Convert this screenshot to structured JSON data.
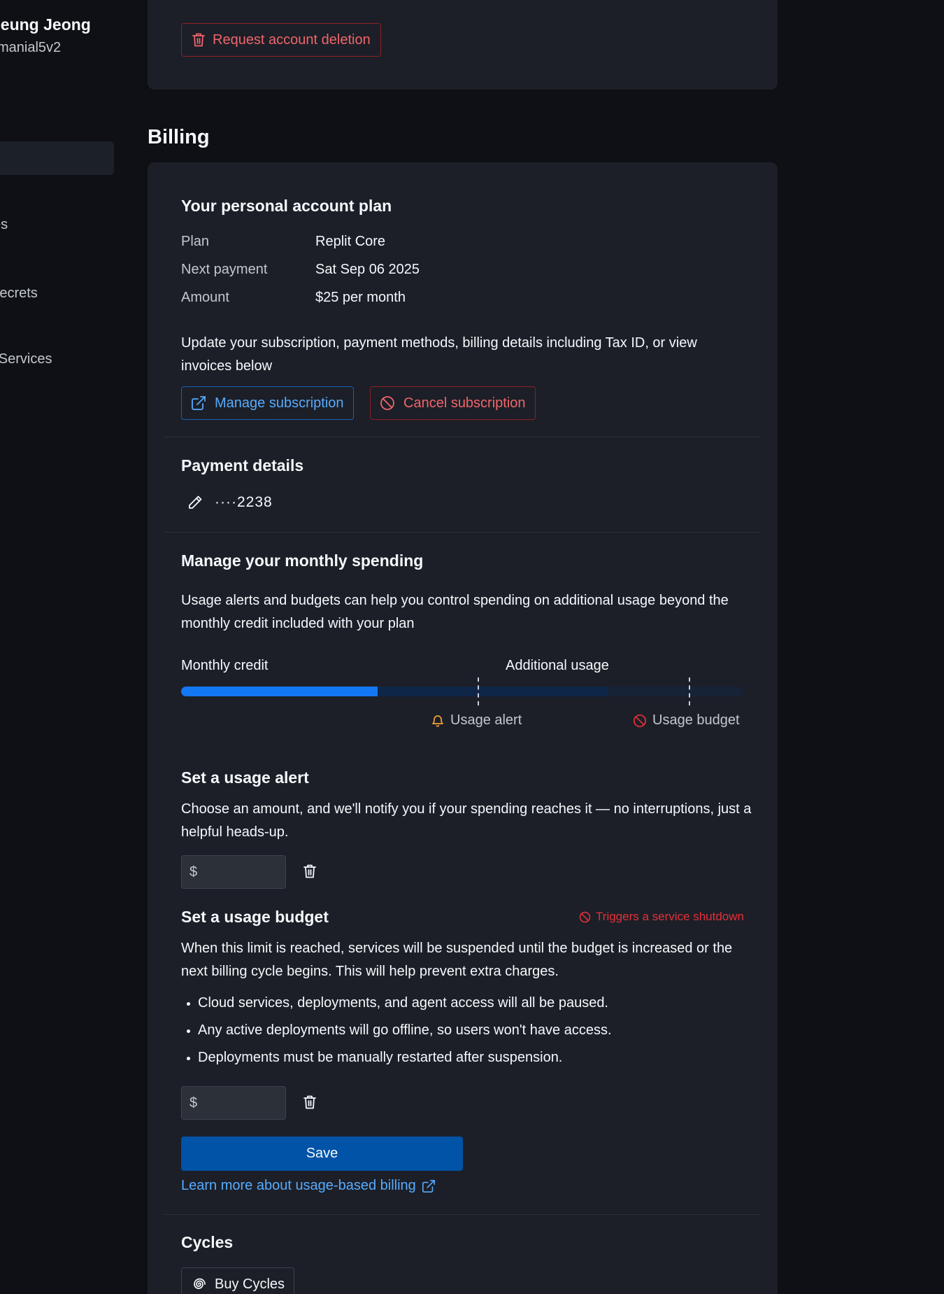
{
  "sidebar": {
    "user_name": "seung Jeong",
    "user_handle": "manial5v2",
    "items": [
      "ces",
      "Secrets",
      "ed Services"
    ]
  },
  "account": {
    "delete_label": "Request account deletion"
  },
  "billing": {
    "title": "Billing",
    "plan_section": {
      "heading": "Your personal account plan",
      "rows": [
        {
          "label": "Plan",
          "value": "Replit Core"
        },
        {
          "label": "Next payment",
          "value": "Sat Sep 06 2025"
        },
        {
          "label": "Amount",
          "value": "$25 per month"
        }
      ],
      "description": "Update your subscription, payment methods, billing details including Tax ID, or view invoices below",
      "manage_label": "Manage subscription",
      "cancel_label": "Cancel subscription"
    },
    "payment": {
      "heading": "Payment details",
      "card_number": "····2238"
    },
    "spending": {
      "heading": "Manage your monthly spending",
      "description": "Usage alerts and budgets can help you control spending on additional usage beyond the monthly credit included with your plan",
      "monthly_credit_label": "Monthly credit",
      "additional_usage_label": "Additional usage",
      "used_fraction": 0.35,
      "usage_alert_label": "Usage alert",
      "usage_budget_label": "Usage budget"
    },
    "alert": {
      "heading": "Set a usage alert",
      "description": "Choose an amount, and we'll notify you if your spending reaches it — no interruptions, just a helpful heads-up.",
      "currency": "$",
      "value": ""
    },
    "budget": {
      "heading": "Set a usage budget",
      "warning": "Triggers a service shutdown",
      "description": "When this limit is reached, services will be suspended until the budget is increased or the next billing cycle begins. This will help prevent extra charges.",
      "bullets": [
        "Cloud services, deployments, and agent access will all be paused.",
        "Any active deployments will go offline, so users won't have access.",
        "Deployments must be manually restarted after suspension."
      ],
      "currency": "$",
      "value": ""
    },
    "save_label": "Save",
    "learn_more_label": "Learn more about usage-based billing",
    "cycles": {
      "heading": "Cycles",
      "buy_label": "Buy Cycles"
    }
  },
  "colors": {
    "background": "#0e1015",
    "card": "#1c1f27",
    "accent_blue": "#1478f5",
    "danger": "#f0656b",
    "link": "#57abff",
    "warning_orange": "#f2a33a"
  }
}
